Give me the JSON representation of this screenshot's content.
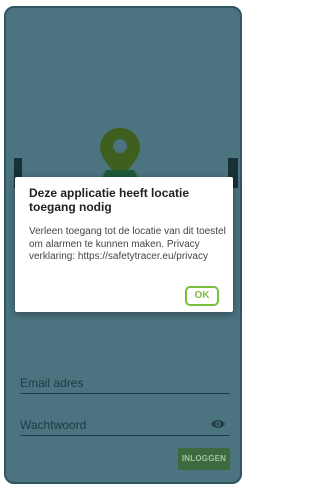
{
  "login": {
    "email_placeholder": "Email adres",
    "password_placeholder": "Wachtwoord",
    "login_button": "INLOGGEN"
  },
  "dialog": {
    "title": "Deze applicatie heeft locatie toegang nodig",
    "message": "Verleen toegang tot de locatie van dit toestel om alarmen te kunnen maken. Privacy verklaring: https://safetytracer.eu/privacy",
    "ok_label": "OK"
  },
  "colors": {
    "background": "#4b7380",
    "accent": "#7bbf3c",
    "login_button": "#3d6b3f"
  }
}
